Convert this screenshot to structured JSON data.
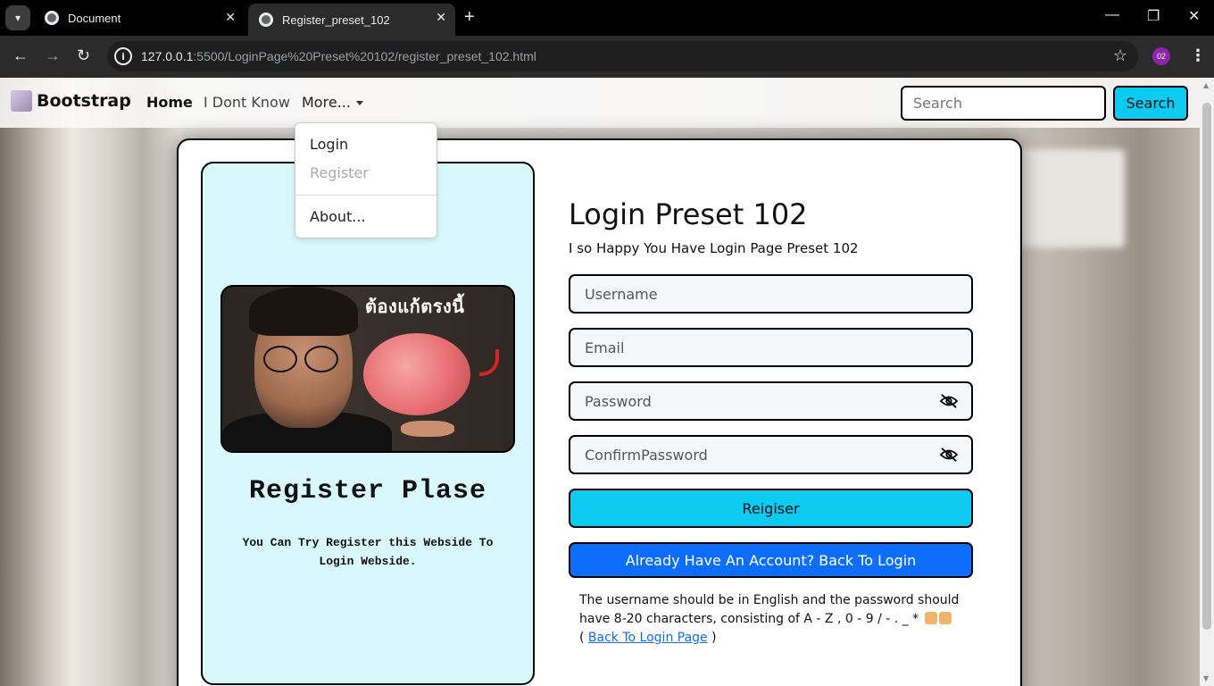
{
  "browser": {
    "tabs": [
      {
        "label": "Document"
      },
      {
        "label": "Register_preset_102"
      }
    ],
    "url_host": "127.0.0.1",
    "url_rest": ":5500/LoginPage%20Preset%20102/register_preset_102.html",
    "profile_badge": "02"
  },
  "navbar": {
    "brand": "Bootstrap",
    "links": [
      "Home",
      "I Dont Know",
      "More..."
    ],
    "search_placeholder": "Search",
    "search_button": "Search"
  },
  "dropdown": {
    "items": [
      "Login",
      "Register",
      "About..."
    ]
  },
  "left_panel": {
    "image_caption": "ต้องแก้ตรงนี้",
    "title": "Register Plase",
    "description": "You Can Try Register this Webside To Login Webside."
  },
  "form": {
    "title": "Login Preset 102",
    "subtitle": "I so Happy You Have Login Page Preset 102",
    "username_placeholder": "Username",
    "email_placeholder": "Email",
    "password_placeholder": "Password",
    "confirm_placeholder": "ConfirmPassword",
    "register_button": "Reigiser",
    "login_button": "Already Have An Account? Back To Login",
    "hint_text": "The username should be in English and the password should have 8-20 characters, consisting of A - Z , 0 - 9 / - . _ *",
    "hint_link_open": "(",
    "hint_link": "Back To Login Page",
    "hint_link_close": ")"
  },
  "colors": {
    "accent_cyan": "#0dcaf0",
    "accent_blue": "#0d6efd",
    "panel_bg": "#d8f8fd"
  }
}
